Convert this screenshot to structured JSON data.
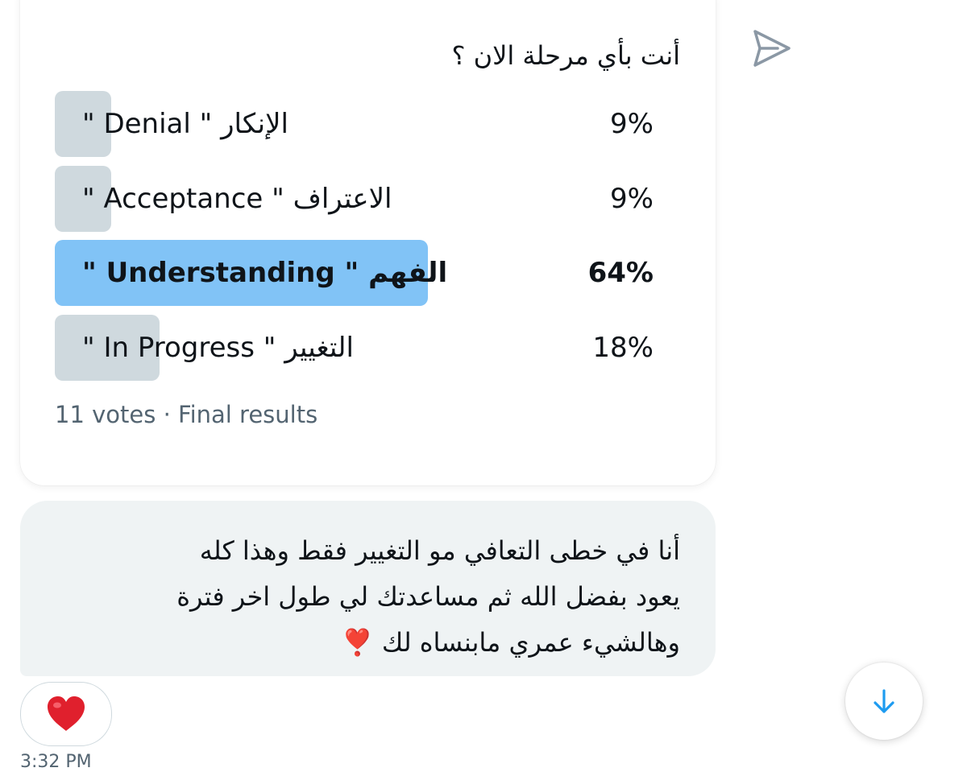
{
  "poll": {
    "question": "أنت بأي مرحلة الان ؟",
    "options": [
      {
        "label": "الإنكار \" Denial \"",
        "percent_text": "9%",
        "percent": 9,
        "winner": false
      },
      {
        "label": "الاعتراف \" Acceptance \"",
        "percent_text": "9%",
        "percent": 9,
        "winner": false
      },
      {
        "label": "الفهم \" Understanding \"",
        "percent_text": "64%",
        "percent": 64,
        "winner": true
      },
      {
        "label": "التغيير \" In Progress \"",
        "percent_text": "18%",
        "percent": 18,
        "winner": false
      }
    ],
    "meta": "11 votes · Final results"
  },
  "message": {
    "text": "أنا في خطى التعافي مو التغيير فقط وهذا كله\nيعود بفضل الله ثم مساعدتك لي طول اخر فترة\nوهالشيء عمري مابنساه لك ❣️"
  },
  "reaction": {
    "emoji": "❤️",
    "icon": "heart-icon"
  },
  "timestamp": "3:32 PM",
  "icons": {
    "send": "send-icon",
    "scroll": "arrow-down-icon"
  },
  "colors": {
    "winner": "#81c3f6",
    "bar": "#cfd9de",
    "bubble": "#eff3f4",
    "accent": "#1d9bf0"
  }
}
